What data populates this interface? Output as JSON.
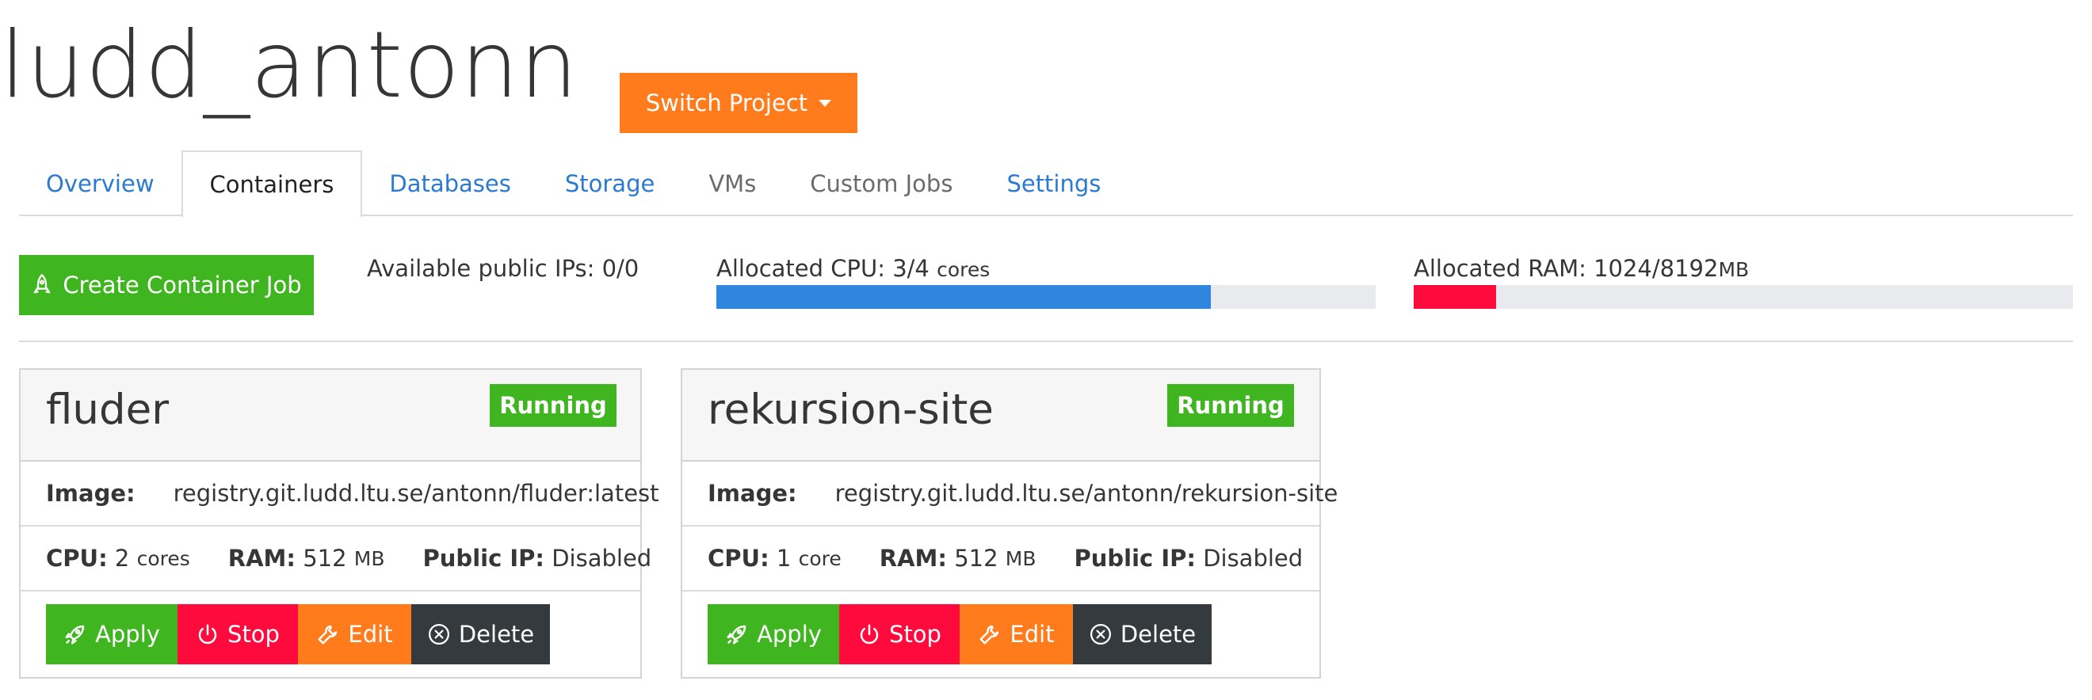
{
  "project": {
    "title": "ludd_antonn",
    "switch_label": "Switch Project"
  },
  "tabs": [
    {
      "label": "Overview",
      "state": "link"
    },
    {
      "label": "Containers",
      "state": "active"
    },
    {
      "label": "Databases",
      "state": "link"
    },
    {
      "label": "Storage",
      "state": "link"
    },
    {
      "label": "VMs",
      "state": "disabled"
    },
    {
      "label": "Custom Jobs",
      "state": "disabled"
    },
    {
      "label": "Settings",
      "state": "link"
    }
  ],
  "create_label": "Create Container Job",
  "stats": {
    "ips": "Available public IPs: 0/0",
    "cpu_label": "Allocated CPU: 3/4",
    "cpu_unit": "cores",
    "cpu_fraction": 0.75,
    "ram_label": "Allocated RAM: 1024/8192",
    "ram_unit": "MB",
    "ram_fraction": 0.125
  },
  "labels": {
    "image": "Image:",
    "cpu": "CPU:",
    "ram": "RAM:",
    "public_ip": "Public IP:",
    "apply": "Apply",
    "stop": "Stop",
    "edit": "Edit",
    "delete": "Delete"
  },
  "containers": [
    {
      "name": "fluder",
      "status": "Running",
      "image": "registry.git.ludd.ltu.se/antonn/fluder:latest",
      "cpu_value": "2",
      "cpu_unit": "cores",
      "ram_value": "512",
      "ram_unit": "MB",
      "public_ip": "Disabled"
    },
    {
      "name": "rekursion-site",
      "status": "Running",
      "image": "registry.git.ludd.ltu.se/antonn/rekursion-site",
      "cpu_value": "1",
      "cpu_unit": "core",
      "ram_value": "512",
      "ram_unit": "MB",
      "public_ip": "Disabled"
    }
  ],
  "colors": {
    "accent_orange": "#ff7b1c",
    "success_green": "#3fb51f",
    "danger_red": "#ff0a3c",
    "dark": "#353a3f",
    "link_blue": "#2b7ad1",
    "cpu_bar": "#2e86de",
    "ram_bar": "#ff0a3c"
  }
}
